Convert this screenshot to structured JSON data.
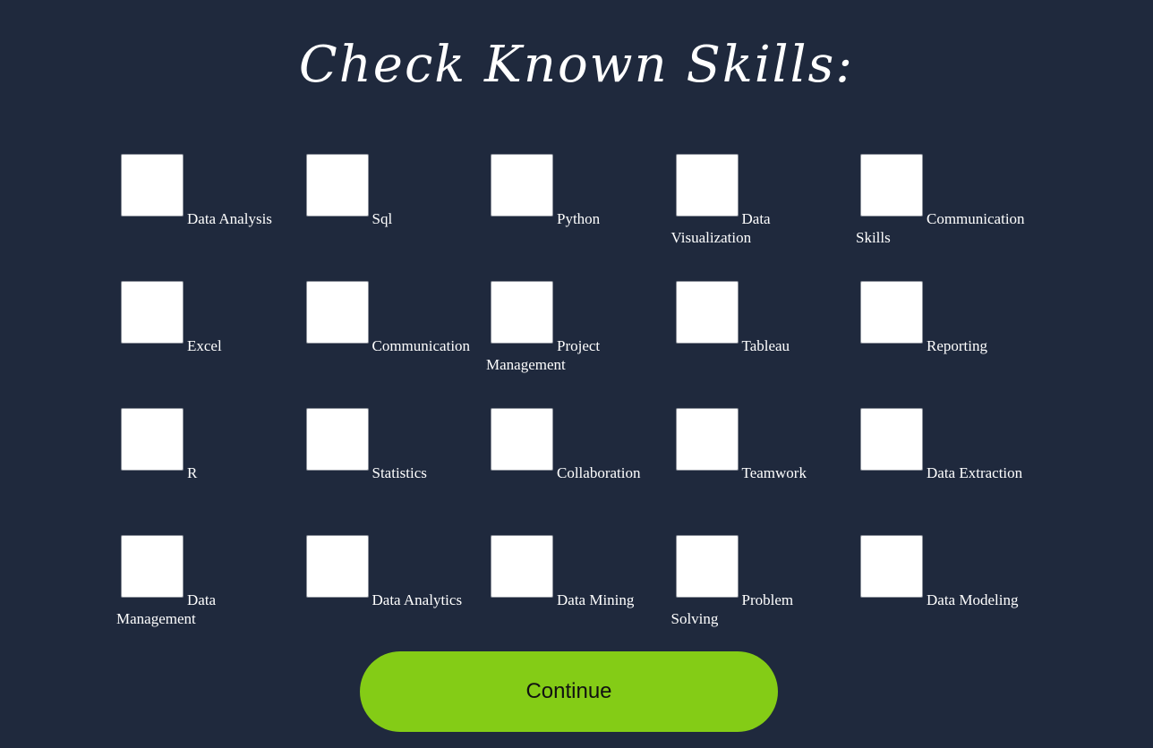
{
  "header": {
    "title": "Check Known Skills:"
  },
  "skills": [
    {
      "label": "Data Analysis",
      "checked": false
    },
    {
      "label": "Sql",
      "checked": false
    },
    {
      "label": "Python",
      "checked": false
    },
    {
      "label": "Data Visualization",
      "checked": false
    },
    {
      "label": "Communication Skills",
      "checked": false
    },
    {
      "label": "Excel",
      "checked": false
    },
    {
      "label": "Communication",
      "checked": false
    },
    {
      "label": "Project Management",
      "checked": false
    },
    {
      "label": "Tableau",
      "checked": false
    },
    {
      "label": "Reporting",
      "checked": false
    },
    {
      "label": "R",
      "checked": false
    },
    {
      "label": "Statistics",
      "checked": false
    },
    {
      "label": "Collaboration",
      "checked": false
    },
    {
      "label": "Teamwork",
      "checked": false
    },
    {
      "label": "Data Extraction",
      "checked": false
    },
    {
      "label": "Data Management",
      "checked": false
    },
    {
      "label": "Data Analytics",
      "checked": false
    },
    {
      "label": "Data Mining",
      "checked": false
    },
    {
      "label": "Problem Solving",
      "checked": false
    },
    {
      "label": "Data Modeling",
      "checked": false
    }
  ],
  "actions": {
    "continue_label": "Continue"
  },
  "colors": {
    "background": "#1f293d",
    "button": "#84cc16"
  }
}
